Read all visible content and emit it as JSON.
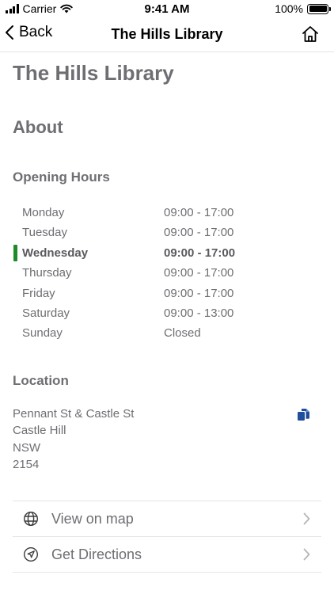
{
  "status_bar": {
    "carrier": "Carrier",
    "time": "9:41 AM",
    "battery": "100%",
    "battery_level": 1.0
  },
  "nav": {
    "back_label": "Back",
    "title": "The Hills Library",
    "home_icon": "home-icon"
  },
  "page": {
    "title": "The Hills Library",
    "about_heading": "About"
  },
  "opening_hours": {
    "heading": "Opening Hours",
    "today_index": 2,
    "today_marker_color": "#1e8a2a",
    "rows": [
      {
        "day": "Monday",
        "hours": "09:00 - 17:00"
      },
      {
        "day": "Tuesday",
        "hours": "09:00 - 17:00"
      },
      {
        "day": "Wednesday",
        "hours": "09:00 - 17:00"
      },
      {
        "day": "Thursday",
        "hours": "09:00 - 17:00"
      },
      {
        "day": "Friday",
        "hours": "09:00 - 17:00"
      },
      {
        "day": "Saturday",
        "hours": "09:00 - 13:00"
      },
      {
        "day": "Sunday",
        "hours": "Closed"
      }
    ]
  },
  "location": {
    "heading": "Location",
    "address_lines": [
      "Pennant St & Castle St",
      "Castle Hill",
      "NSW",
      "2154"
    ],
    "copy_icon": "copy-icon",
    "copy_icon_color": "#1f4e9c"
  },
  "actions": [
    {
      "label": "View on map",
      "icon": "globe-icon"
    },
    {
      "label": "Get Directions",
      "icon": "navigation-arrow-icon"
    }
  ]
}
